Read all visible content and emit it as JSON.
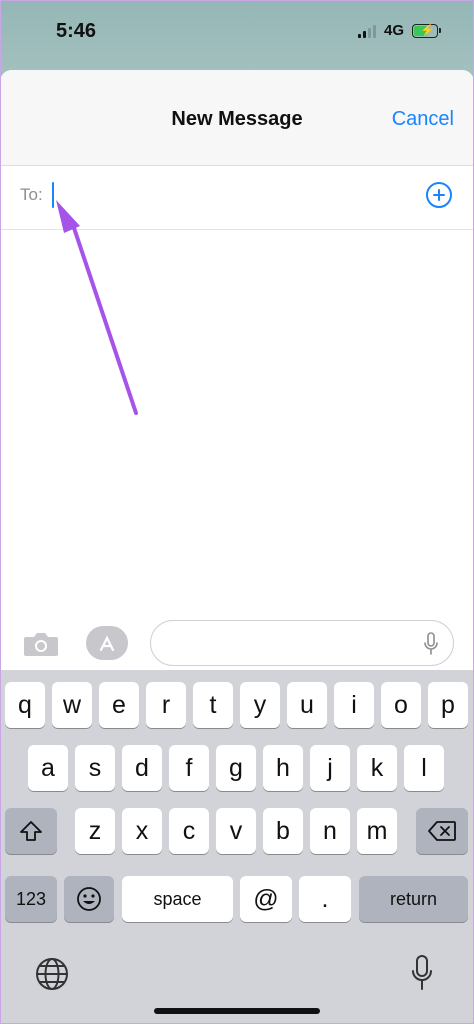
{
  "status_bar": {
    "time": "5:46",
    "network": "4G"
  },
  "nav": {
    "title": "New Message",
    "cancel_label": "Cancel"
  },
  "to_field": {
    "label": "To:",
    "value": ""
  },
  "keyboard": {
    "row1": [
      "q",
      "w",
      "e",
      "r",
      "t",
      "y",
      "u",
      "i",
      "o",
      "p"
    ],
    "row2": [
      "a",
      "s",
      "d",
      "f",
      "g",
      "h",
      "j",
      "k",
      "l"
    ],
    "row3": [
      "z",
      "x",
      "c",
      "v",
      "b",
      "n",
      "m"
    ],
    "numbers_label": "123",
    "space_label": "space",
    "at_label": "@",
    "period_label": ".",
    "return_label": "return"
  },
  "colors": {
    "accent": "#1a84ff",
    "annotation_arrow": "#a553e8",
    "keyboard_bg": "#d1d3d9"
  },
  "icons": {
    "add_contact": "plus-circle-icon",
    "camera": "camera-icon",
    "apps": "app-store-icon",
    "dictation": "microphone-icon",
    "shift": "shift-icon",
    "delete": "backspace-icon",
    "emoji": "emoji-icon",
    "globe": "globe-icon"
  }
}
